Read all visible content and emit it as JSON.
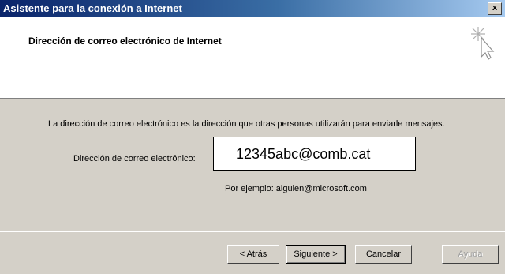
{
  "window": {
    "title": "Asistente para la conexión a Internet",
    "close_label": "x"
  },
  "header": {
    "title": "Dirección de correo electrónico de Internet",
    "icon": "wizard-cursor-sparkle-icon"
  },
  "body": {
    "description": "La dirección de correo electrónico es la dirección que otras personas utilizarán para enviarle mensajes.",
    "email_label": "Dirección de correo electrónico:",
    "email_value": "12345abc@comb.cat",
    "example": "Por ejemplo: alguien@microsoft.com"
  },
  "buttons": {
    "back": "< Atrás",
    "next": "Siguiente >",
    "cancel": "Cancelar",
    "help": "Ayuda"
  }
}
